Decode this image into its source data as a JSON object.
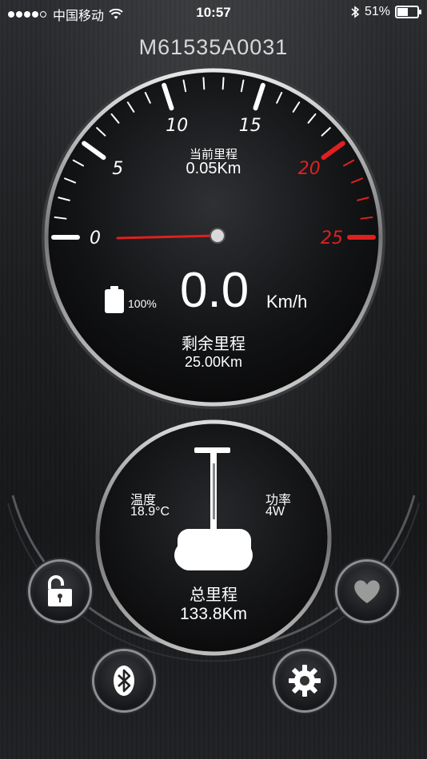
{
  "status_bar": {
    "carrier": "中国移动",
    "time": "10:57",
    "battery": "51%"
  },
  "device": {
    "id": "M61535A0031"
  },
  "speedometer": {
    "scale_labels": [
      "0",
      "5",
      "10",
      "15",
      "20",
      "25"
    ],
    "trip_label": "当前里程",
    "trip_value": "0.05Km",
    "speed_value": "0.0",
    "speed_unit": "Km/h",
    "battery_percent": "100%",
    "remaining_label": "剩余里程",
    "remaining_value": "25.00Km",
    "needle_speed": 0,
    "max_speed": 25,
    "red_zone_start": 20
  },
  "stats": {
    "temperature_label": "温度",
    "temperature_value": "18.9°C",
    "power_label": "功率",
    "power_value": "4W",
    "total_label": "总里程",
    "total_value": "133.8Km"
  },
  "buttons": {
    "lock_icon": "unlock-icon",
    "heart_icon": "heart-icon",
    "bluetooth_icon": "bluetooth-icon",
    "settings_icon": "gear-icon"
  },
  "colors": {
    "accent_red": "#e0201e",
    "tick_white": "#ffffff"
  }
}
